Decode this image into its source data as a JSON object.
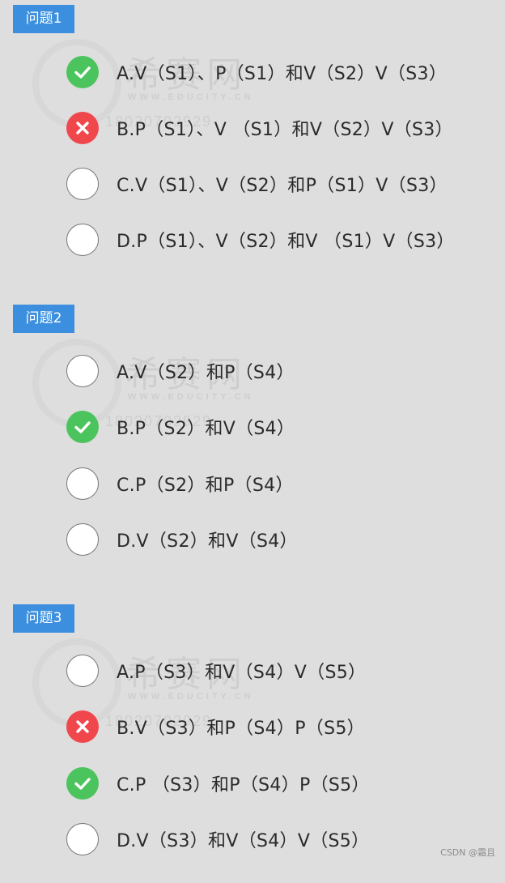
{
  "questions": [
    {
      "label": "问题1",
      "options": [
        {
          "text": "A.V（S1）、P（S1）和V（S2）V（S3）",
          "state": "correct"
        },
        {
          "text": "B.P（S1）、V （S1）和V（S2）V（S3）",
          "state": "wrong"
        },
        {
          "text": "C.V（S1）、V（S2）和P（S1）V（S3）",
          "state": "none"
        },
        {
          "text": "D.P（S1）、V（S2）和V （S1）V（S3）",
          "state": "none"
        }
      ]
    },
    {
      "label": "问题2",
      "options": [
        {
          "text": "A.V（S2）和P（S4）",
          "state": "none"
        },
        {
          "text": "B.P（S2）和V（S4）",
          "state": "correct"
        },
        {
          "text": "C.P（S2）和P（S4）",
          "state": "none"
        },
        {
          "text": "D.V（S2）和V（S4）",
          "state": "none"
        }
      ]
    },
    {
      "label": "问题3",
      "options": [
        {
          "text": "A.P（S3）和V（S4）V（S5）",
          "state": "none"
        },
        {
          "text": "B.V（S3）和P（S4）P（S5）",
          "state": "wrong"
        },
        {
          "text": "C.P （S3）和P（S4）P（S5）",
          "state": "correct"
        },
        {
          "text": "D.V（S3）和V（S4）V（S5）",
          "state": "none"
        }
      ]
    }
  ],
  "watermark": {
    "title": "希赛网",
    "url": "WWW.EDUCITY.CN",
    "code": "18020702929"
  },
  "footer": {
    "credit": "CSDN @霜且"
  },
  "colors": {
    "tag_bg": "#3b8fde",
    "correct": "#4cc45d",
    "wrong": "#f0474d",
    "page_bg": "#dedede"
  },
  "icons": {
    "correct": "check-icon",
    "wrong": "cross-icon",
    "none": "radio-empty-icon"
  }
}
